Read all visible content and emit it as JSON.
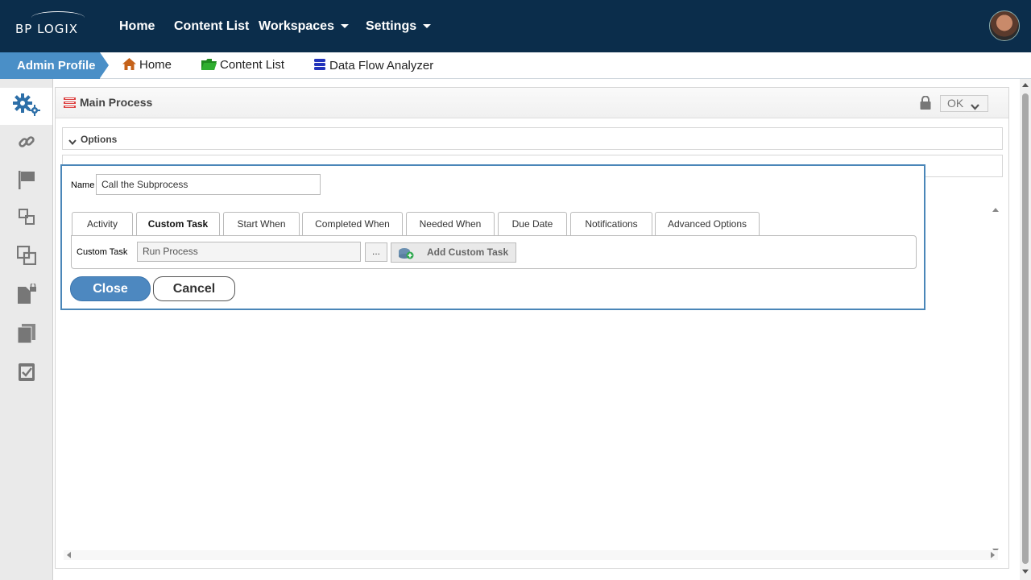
{
  "topbar": {
    "logo": "BP LOGIX",
    "nav": [
      {
        "label": "Home"
      },
      {
        "label": "Content List"
      },
      {
        "label": "Workspaces"
      },
      {
        "label": "Settings"
      }
    ]
  },
  "breadcrumb": {
    "admin_profile": "Admin Profile",
    "items": [
      {
        "label": "Home",
        "icon": "home-icon"
      },
      {
        "label": "Content List",
        "icon": "folder-icon"
      },
      {
        "label": "Data Flow Analyzer",
        "icon": "database-icon"
      }
    ]
  },
  "sidebar": {
    "items": [
      {
        "icon": "gears-icon",
        "active": true
      },
      {
        "icon": "link-icon"
      },
      {
        "icon": "flag-icon"
      },
      {
        "icon": "subprocess-icon"
      },
      {
        "icon": "copy-shapes-icon"
      },
      {
        "icon": "locked-document-icon"
      },
      {
        "icon": "documents-icon"
      },
      {
        "icon": "checkbox-icon"
      }
    ]
  },
  "panel": {
    "title": "Main Process",
    "ok_label": "OK",
    "options_label": "Options"
  },
  "dialog": {
    "name_label": "Name",
    "name_value": "Call the Subprocess",
    "tabs": [
      {
        "label": "Activity"
      },
      {
        "label": "Custom Task",
        "active": true
      },
      {
        "label": "Start When"
      },
      {
        "label": "Completed When"
      },
      {
        "label": "Needed When"
      },
      {
        "label": "Due Date"
      },
      {
        "label": "Notifications"
      },
      {
        "label": "Advanced Options"
      }
    ],
    "custom_task_label": "Custom Task",
    "custom_task_value": "Run Process",
    "browse_label": "...",
    "add_custom_task_label": "Add Custom Task",
    "close_label": "Close",
    "cancel_label": "Cancel"
  },
  "colors": {
    "topbar": "#0b2d4b",
    "accent": "#4a8fc7",
    "close_button": "#4d88c0"
  }
}
